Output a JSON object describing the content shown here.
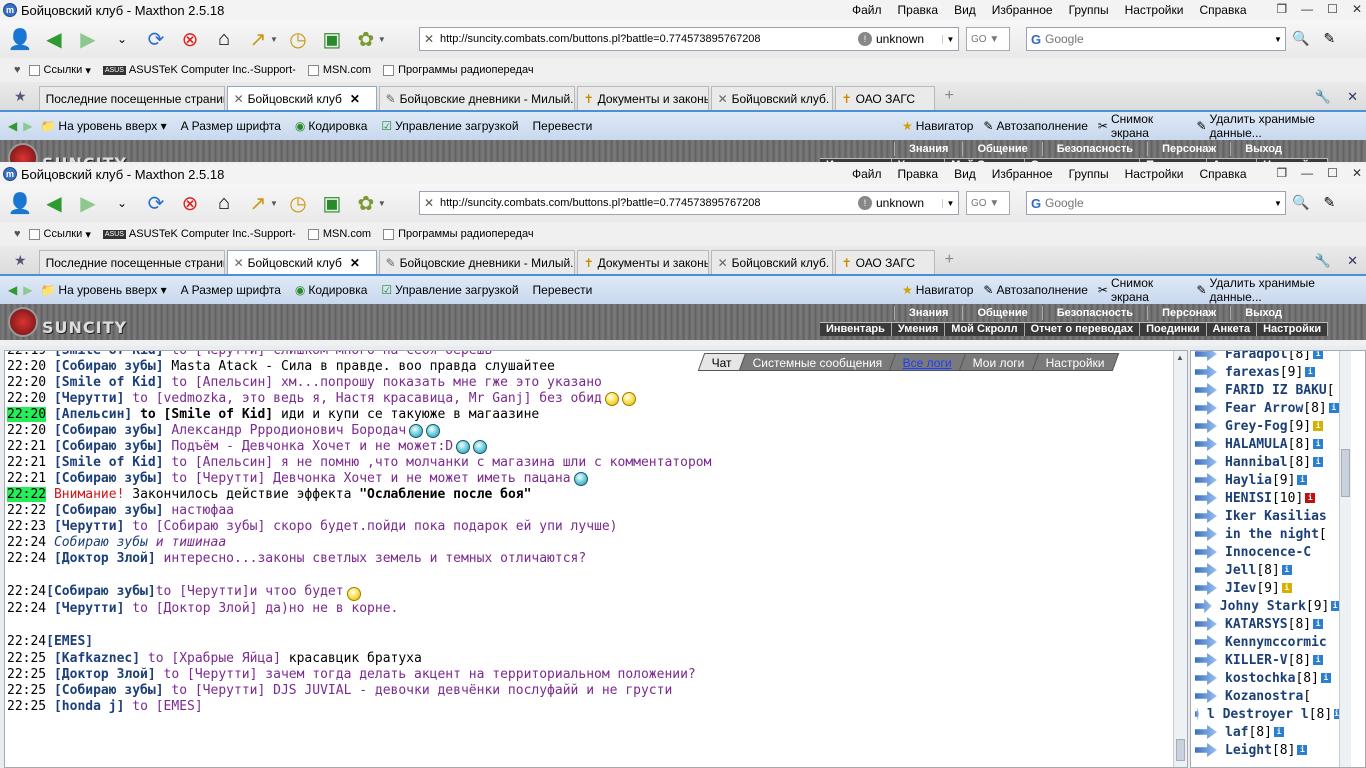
{
  "window": {
    "title": "Бойцовский клуб - Maxthon 2.5.18",
    "menu": [
      "Файл",
      "Правка",
      "Вид",
      "Избранное",
      "Группы",
      "Настройки",
      "Справка"
    ]
  },
  "toolbar": {
    "address": "http://suncity.combats.com/buttons.pl?battle=0.774573895767208",
    "security": "unknown",
    "go_label": "GO",
    "search_placeholder": "Google"
  },
  "links_bar": [
    "Ссылки",
    "ASUSTeK Computer Inc.-Support-",
    "MSN.com",
    "Программы радиопередач"
  ],
  "tabs": [
    {
      "label": "Последние посещенные страницы",
      "active": false
    },
    {
      "label": "Бойцовский клуб",
      "active": true
    },
    {
      "label": "Бойцовские дневники - Милый...",
      "active": false
    },
    {
      "label": "Документы и законы",
      "active": false
    },
    {
      "label": "Бойцовский клуб.",
      "active": false
    },
    {
      "label": "ОАО ЗАГС",
      "active": false
    }
  ],
  "ext_bar": {
    "left": [
      "На уровень вверх",
      "Размер шрифта",
      "Кодировка",
      "Управление загрузкой",
      "Перевести"
    ],
    "right": [
      "Навигатор",
      "Автозаполнение",
      "Снимок экрана",
      "Удалить хранимые данные..."
    ]
  },
  "game_nav": {
    "logo": "SUNCITY",
    "top": [
      "Знания",
      "Общение",
      "Безопасность",
      "Персонаж",
      "Выход"
    ],
    "bottom": [
      "Инвентарь",
      "Умения",
      "Мой Скролл",
      "Отчет о переводах",
      "Поединки",
      "Анкета",
      "Настройки"
    ]
  },
  "chat_tabs": [
    "Чат",
    "Системные сообщения",
    "Все логи",
    "Мои логи",
    "Настройки"
  ],
  "chat": [
    {
      "t": "22:19",
      "n": "[Smile of Kid]",
      "to": " to [Черутти] ",
      "m": "слишком много на себя берешь"
    },
    {
      "t": "22:20",
      "n": "[Собираю зубы]",
      "to": " ",
      "m": "Masta Atack - Сила в правде. воо правда слушайтее"
    },
    {
      "t": "22:20",
      "n": "[Smile of Kid]",
      "to": " to [Апельсин] ",
      "m": "хм...попрошу показать мне гже это указано"
    },
    {
      "t": "22:20",
      "n": "[Черутти]",
      "to": " to [vedmozka, это ведь я, Настя красавица, Mr Ganj] ",
      "m": "без обид"
    },
    {
      "t": "22:20",
      "n": "[Апельсин]",
      "to": " to [Smile of Kid] ",
      "m": "иди и купи се такуюже в магаазине"
    },
    {
      "t": "22:20",
      "n": "[Собираю зубы]",
      "to": " ",
      "m": "Александр Ррродионович Бородач"
    },
    {
      "t": "22:21",
      "n": "[Собираю зубы]",
      "to": " ",
      "m": "Подъём - Девчонка Хочет и не может:D"
    },
    {
      "t": "22:21",
      "n": "[Smile of Kid]",
      "to": " to [Апельсин] ",
      "m": "я не помню ,что молчанки с магазина шли с комментатором"
    },
    {
      "t": "22:21",
      "n": "[Собираю зубы]",
      "to": " to [Черутти] ",
      "m": "Девчонка Хочет и не может иметь пацана"
    },
    {
      "t": "22:22",
      "warn": "Внимание!",
      "sys": " Закончилось действие эффекта ",
      "eff": "\"Ослабление после боя\""
    },
    {
      "t": "22:22",
      "n": "[Собираю зубы]",
      "to": " ",
      "m": "настюфаа"
    },
    {
      "t": "22:23",
      "n": "[Черутти]",
      "to": " to [Собираю зубы] ",
      "m": "скоро будет.пойди пока подарок ей упи лучше)"
    },
    {
      "t": "22:24",
      "n": "Собираю зубы",
      "to": " ",
      "m": "и тишинаа"
    },
    {
      "t": "22:24",
      "n": "[Доктор Злой]",
      "to": " ",
      "m": "интересно...законы светлых земель и темных отличаются?"
    },
    {
      "t": "22:24",
      "n": "[Собираю зубы]",
      "to": " to [Черутти] ",
      "m": "и чтоо будет"
    },
    {
      "t": "22:24",
      "n": "[Черутти]",
      "to": " to [Доктор Злой] ",
      "m": "да)но не в корне."
    },
    {
      "t": "22:24",
      "n": "[EMES]",
      "to": "",
      "m": ""
    },
    {
      "t": "22:25",
      "n": "[Kafkaznec]",
      "to": " to [Храбрые Яйца] ",
      "m": "красавцик братуха"
    },
    {
      "t": "22:25",
      "n": "[Доктор Злой]",
      "to": " to [Черутти] ",
      "m": "зачем тогда делать акцент на территориальном положении?"
    },
    {
      "t": "22:25",
      "n": "[Собираю зубы]",
      "to": " to [Черутти] ",
      "m": "DJS JUVIAL - девочки девчёнки послуфайй и не грусти"
    },
    {
      "t": "22:25",
      "n": "[honda j]",
      "to": " to [EMES]",
      "m": ""
    }
  ],
  "users": [
    {
      "name": "Faradpol",
      "lvl": "[8]",
      "inf": "b"
    },
    {
      "name": "farexas",
      "lvl": "[9]",
      "inf": "b"
    },
    {
      "name": "FARID IZ BAKU",
      "lvl": "[",
      "inf": ""
    },
    {
      "name": "Fear Arrow",
      "lvl": "[8]",
      "inf": "b"
    },
    {
      "name": "Grey-Fog",
      "lvl": "[9]",
      "inf": "y"
    },
    {
      "name": "HALAMULA",
      "lvl": "[8]",
      "inf": "b"
    },
    {
      "name": "Hannibal",
      "lvl": "[8]",
      "inf": "b"
    },
    {
      "name": "Haylia",
      "lvl": "[9]",
      "inf": "b"
    },
    {
      "name": "HENISI",
      "lvl": "[10]",
      "inf": "r"
    },
    {
      "name": "Iker Kasilias",
      "lvl": "",
      "inf": ""
    },
    {
      "name": "in the night",
      "lvl": "[",
      "inf": ""
    },
    {
      "name": "Innocence-C",
      "lvl": "",
      "inf": ""
    },
    {
      "name": "Jell",
      "lvl": "[8]",
      "inf": "b"
    },
    {
      "name": "JIev",
      "lvl": "[9]",
      "inf": "y"
    },
    {
      "name": "Johny Stark",
      "lvl": "[9]",
      "inf": "b"
    },
    {
      "name": "KATARSYS",
      "lvl": "[8]",
      "inf": "b"
    },
    {
      "name": "Kennymccormic",
      "lvl": "",
      "inf": ""
    },
    {
      "name": "KILLER-V",
      "lvl": "[8]",
      "inf": "b"
    },
    {
      "name": "kostochka",
      "lvl": "[8]",
      "inf": "b"
    },
    {
      "name": "Kozanostra",
      "lvl": "[",
      "inf": ""
    },
    {
      "name": "l Destroyer l",
      "lvl": "[8]",
      "inf": "b"
    },
    {
      "name": "laf",
      "lvl": "[8]",
      "inf": "b"
    },
    {
      "name": "Leight",
      "lvl": "[8]",
      "inf": "b"
    }
  ]
}
